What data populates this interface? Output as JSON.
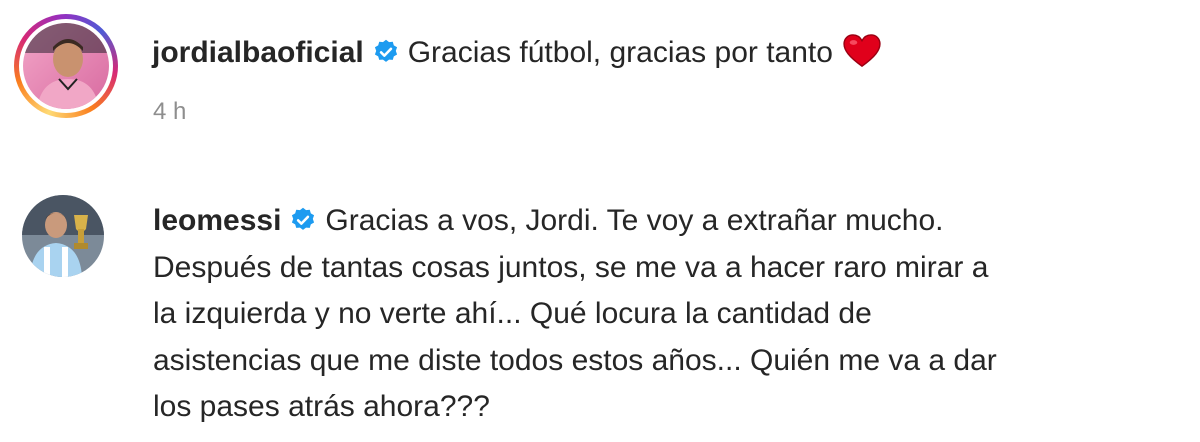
{
  "post": {
    "username": "jordialbaoficial",
    "verified": true,
    "caption": "Gracias fútbol, gracias por tanto",
    "time": "4 h"
  },
  "reply": {
    "username": "leomessi",
    "verified": true,
    "lines": [
      "Gracias a vos, Jordi. Te voy a extrañar mucho.",
      "Después de tantas cosas juntos, se me va a hacer raro mirar a",
      "la izquierda y no verte ahí... Qué locura la cantidad de",
      "asistencias que me diste todos estos años... Quién me va a dar",
      "los pases atrás ahora???"
    ]
  },
  "colors": {
    "verified_blue": "#1d9bf0",
    "heart_red": "#e0001b",
    "text": "#262626",
    "muted": "#8e8e8e"
  }
}
